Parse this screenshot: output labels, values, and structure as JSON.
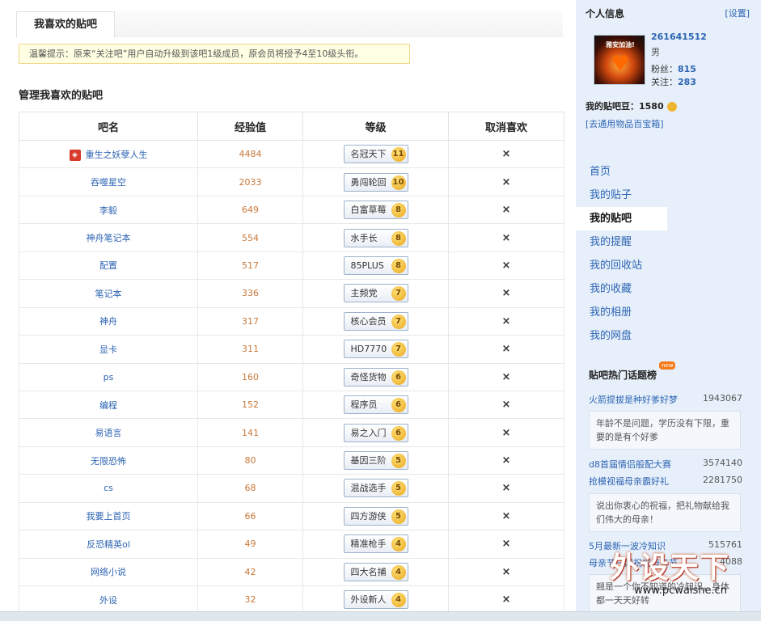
{
  "tabs": {
    "active": "我喜欢的贴吧"
  },
  "tip": "温馨提示：原来“关注吧”用户自动升级到该吧1级成员，原会员将授予4至10级头衔。",
  "manage_title": "管理我喜欢的贴吧",
  "table": {
    "headers": [
      "吧名",
      "经验值",
      "等级",
      "取消喜欢"
    ],
    "cancel_symbol": "×",
    "rows": [
      {
        "name": "重生之妖孽人生",
        "exp": "4484",
        "title": "名冠天下",
        "level": "11",
        "icon": true
      },
      {
        "name": "吞噬星空",
        "exp": "2033",
        "title": "勇闯轮回",
        "level": "10"
      },
      {
        "name": "李毅",
        "exp": "649",
        "title": "白富草莓",
        "level": "8"
      },
      {
        "name": "神舟笔记本",
        "exp": "554",
        "title": "水手长",
        "level": "8"
      },
      {
        "name": "配置",
        "exp": "517",
        "title": "85PLUS",
        "level": "8"
      },
      {
        "name": "笔记本",
        "exp": "336",
        "title": "主频党",
        "level": "7"
      },
      {
        "name": "神舟",
        "exp": "317",
        "title": "核心会员",
        "level": "7"
      },
      {
        "name": "显卡",
        "exp": "311",
        "title": "HD7770",
        "level": "7"
      },
      {
        "name": "ps",
        "exp": "160",
        "title": "奇怪货物",
        "level": "6"
      },
      {
        "name": "编程",
        "exp": "152",
        "title": "程序员",
        "level": "6"
      },
      {
        "name": "易语言",
        "exp": "141",
        "title": "易之入门",
        "level": "6"
      },
      {
        "name": "无限恐怖",
        "exp": "80",
        "title": "基因三阶",
        "level": "5"
      },
      {
        "name": "cs",
        "exp": "68",
        "title": "混战选手",
        "level": "5"
      },
      {
        "name": "我要上首页",
        "exp": "66",
        "title": "四方游侠",
        "level": "5"
      },
      {
        "name": "反恐精英ol",
        "exp": "49",
        "title": "精准枪手",
        "level": "4"
      },
      {
        "name": "网络小说",
        "exp": "42",
        "title": "四大名捕",
        "level": "4"
      },
      {
        "name": "外设",
        "exp": "32",
        "title": "外设新人",
        "level": "4"
      }
    ]
  },
  "sidebar": {
    "heading": "个人信息",
    "settings": "[设置]",
    "avatar_caption": "雅安加油!",
    "username": "261641512",
    "gender": "男",
    "fans_label": "粉丝：",
    "fans": "815",
    "follow_label": "关注：",
    "follow": "283",
    "beans_label": "我的贴吧豆：",
    "beans": "1580",
    "treasure": "[去通用物品百宝箱]",
    "nav": [
      "首页",
      "我的贴子",
      "我的贴吧",
      "我的提醒",
      "我的回收站",
      "我的收藏",
      "我的相册",
      "我的网盘"
    ],
    "nav_active": 2,
    "hot_title": "贴吧热门话题榜",
    "hot_badge": "new",
    "hot": [
      {
        "topic": "火箭提拔是种好爹好梦",
        "count": "1943067",
        "desc": "年龄不是问题，学历没有下限，重要的是有个好爹"
      },
      {
        "topic": "d8首届情侣般配大赛",
        "count": "3574140"
      },
      {
        "topic": "抢模视福母亲霸好礼",
        "count": "2281750",
        "desc": "说出你衷心的祝福，把礼物献给我们伟大的母亲！"
      },
      {
        "topic": "5月最新一波冷知识",
        "count": "515761"
      },
      {
        "topic": "母亲节一起祝福母亲节",
        "count": "4088"
      }
    ],
    "hot_last_desc": "翘是一个你不知道的冷知识，身体都一天天好转"
  },
  "watermark": {
    "logo": "外设天下",
    "url": "www.pcwaishe.cn"
  }
}
